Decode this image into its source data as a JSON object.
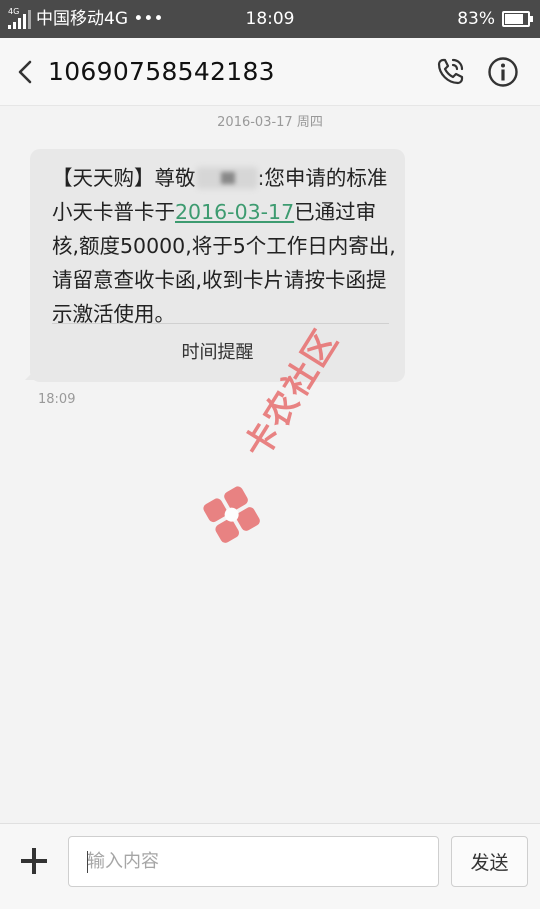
{
  "status_bar": {
    "network_tag": "4G",
    "carrier": "中国移动4G •••",
    "time": "18:09",
    "battery_percent_label": "83%",
    "battery_level": 0.83
  },
  "header": {
    "title": "10690758542183",
    "back_icon": "chevron-left-icon",
    "call_icon": "phone-icon",
    "info_icon": "info-icon"
  },
  "conversation": {
    "date_separator": "2016-03-17 周四",
    "message": {
      "text_before_redaction": "【天天购】尊敬",
      "text_after_redaction": ":您申请的标准小天卡普卡于",
      "date_link": "2016-03-17",
      "text_after_link": "已通过审核,额度50000,将于5个工作日内寄出,请留意查收卡函,收到卡片请按卡函提示激活使用。",
      "action_label": "时间提醒",
      "time": "18:09"
    }
  },
  "watermark": {
    "text": "卡农社区",
    "color": "#e76f6f"
  },
  "composer": {
    "add_icon": "plus-icon",
    "input_placeholder": "输入内容",
    "send_label": "发送"
  },
  "colors": {
    "status_bar_bg": "#4a4a4a",
    "bubble_bg": "#e8e8e8",
    "link_color": "#3d9b70"
  }
}
